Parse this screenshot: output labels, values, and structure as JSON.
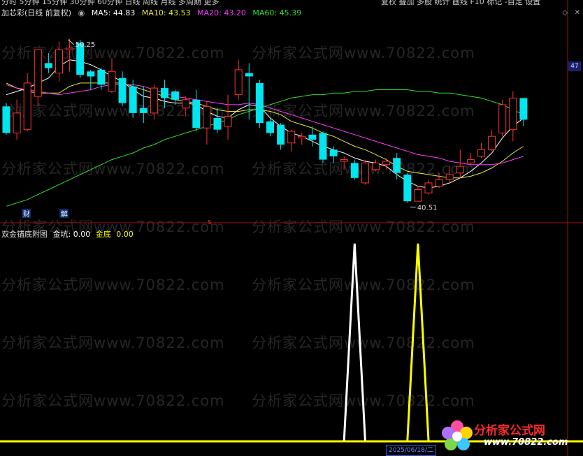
{
  "app": {
    "stock_title": "加芯彩(日线 前复权)",
    "top_tabs": [
      "分时",
      "5分钟",
      "15分钟",
      "30分钟",
      "60分钟",
      "日线",
      "周线",
      "月线",
      "多周期",
      "更多"
    ],
    "top_right": [
      "复权",
      "叠加",
      "多股",
      "统计",
      "画线",
      "F10",
      "标记",
      "-自定",
      "设置"
    ]
  },
  "main_legend": {
    "ma5": "MA5: 44.83",
    "ma10": "MA10: 43.53",
    "ma20": "MA20: 43.20",
    "ma60": "MA60: 45.39"
  },
  "sub_legend": {
    "title": "双金锚底附图",
    "jinkeng": "金坑: 0.00",
    "jindi": "金底",
    "jindi_val": "0.00"
  },
  "annotations": {
    "high_label": "50.25",
    "low_label": "40.51",
    "cai_badge": "财",
    "jie_badge": "解",
    "s_marker": "S",
    "right_badge": "47",
    "date_tag": "2025/06/18/二"
  },
  "logo": {
    "brand": "分析家公式网",
    "url": "www.70822.com"
  },
  "watermark": "分析家公式网www.70822.com",
  "colors": {
    "up": "#ff3232",
    "down": "#00e5ee",
    "ma5": "#ffffff",
    "ma10": "#e8e83a",
    "ma20": "#ff3cff",
    "ma60": "#33dd33",
    "white_spike": "#ffffff",
    "yellow_spike": "#ffff00",
    "axis": "#a01010"
  },
  "chart_data": [
    {
      "type": "candlestick",
      "title": "加芯彩(日线 前复权)",
      "ylim": [
        39.5,
        51.5
      ],
      "candles": [
        {
          "o": 46.2,
          "c": 44.6,
          "h": 46.4,
          "l": 44.5
        },
        {
          "o": 44.6,
          "c": 45.8,
          "h": 46.6,
          "l": 44.2
        },
        {
          "o": 44.8,
          "c": 47.6,
          "h": 48.2,
          "l": 44.7
        },
        {
          "o": 46.8,
          "c": 49.6,
          "h": 49.6,
          "l": 46.2
        },
        {
          "o": 48.8,
          "c": 48.5,
          "h": 49.4,
          "l": 48.2
        },
        {
          "o": 48.2,
          "c": 49.6,
          "h": 50.1,
          "l": 47.7
        },
        {
          "o": 49.6,
          "c": 49.7,
          "h": 50.25,
          "l": 48.3
        },
        {
          "o": 50.0,
          "c": 48.1,
          "h": 50.2,
          "l": 47.9
        },
        {
          "o": 48.3,
          "c": 48.0,
          "h": 48.4,
          "l": 47.2
        },
        {
          "o": 48.4,
          "c": 47.5,
          "h": 48.5,
          "l": 47.2
        },
        {
          "o": 47.1,
          "c": 48.3,
          "h": 49.1,
          "l": 47.0
        },
        {
          "o": 47.9,
          "c": 46.4,
          "h": 48.3,
          "l": 46.2
        },
        {
          "o": 47.4,
          "c": 45.8,
          "h": 47.8,
          "l": 45.5
        },
        {
          "o": 46.1,
          "c": 45.8,
          "h": 47.4,
          "l": 45.2
        },
        {
          "o": 45.8,
          "c": 47.3,
          "h": 47.5,
          "l": 45.4
        },
        {
          "o": 47.3,
          "c": 46.7,
          "h": 47.8,
          "l": 46.1
        },
        {
          "o": 47.1,
          "c": 46.6,
          "h": 47.2,
          "l": 46.3
        },
        {
          "o": 46.1,
          "c": 46.6,
          "h": 46.8,
          "l": 45.6
        },
        {
          "o": 46.6,
          "c": 44.9,
          "h": 47.2,
          "l": 44.7
        },
        {
          "o": 44.9,
          "c": 46.2,
          "h": 46.5,
          "l": 43.9
        },
        {
          "o": 45.5,
          "c": 44.8,
          "h": 46.1,
          "l": 44.6
        },
        {
          "o": 45.0,
          "c": 45.6,
          "h": 46.9,
          "l": 44.2
        },
        {
          "o": 46.9,
          "c": 48.4,
          "h": 49.0,
          "l": 46.6
        },
        {
          "o": 48.2,
          "c": 48.0,
          "h": 48.8,
          "l": 45.4
        },
        {
          "o": 47.6,
          "c": 45.2,
          "h": 47.8,
          "l": 44.9
        },
        {
          "o": 45.3,
          "c": 44.6,
          "h": 45.5,
          "l": 44.4
        },
        {
          "o": 45.1,
          "c": 43.9,
          "h": 45.2,
          "l": 43.6
        },
        {
          "o": 44.0,
          "c": 44.7,
          "h": 44.8,
          "l": 43.5
        },
        {
          "o": 44.3,
          "c": 44.4,
          "h": 44.6,
          "l": 43.9
        },
        {
          "o": 44.5,
          "c": 44.2,
          "h": 45.0,
          "l": 43.8
        },
        {
          "o": 44.6,
          "c": 43.0,
          "h": 44.7,
          "l": 42.8
        },
        {
          "o": 43.6,
          "c": 43.2,
          "h": 43.8,
          "l": 42.8
        },
        {
          "o": 42.9,
          "c": 43.0,
          "h": 43.2,
          "l": 42.4
        },
        {
          "o": 42.8,
          "c": 41.9,
          "h": 43.0,
          "l": 41.8
        },
        {
          "o": 41.6,
          "c": 42.8,
          "h": 43.0,
          "l": 41.5
        },
        {
          "o": 42.4,
          "c": 42.8,
          "h": 43.0,
          "l": 42.3
        },
        {
          "o": 42.7,
          "c": 42.9,
          "h": 43.1,
          "l": 42.4
        },
        {
          "o": 43.1,
          "c": 42.2,
          "h": 43.4,
          "l": 41.8
        },
        {
          "o": 42.1,
          "c": 40.5,
          "h": 42.2,
          "l": 40.4
        },
        {
          "o": 40.5,
          "c": 41.2,
          "h": 41.4,
          "l": 40.51
        },
        {
          "o": 41.0,
          "c": 41.6,
          "h": 41.8,
          "l": 40.9
        },
        {
          "o": 41.4,
          "c": 41.8,
          "h": 42.2,
          "l": 41.3
        },
        {
          "o": 41.8,
          "c": 42.1,
          "h": 42.6,
          "l": 41.6
        },
        {
          "o": 42.2,
          "c": 42.6,
          "h": 43.6,
          "l": 41.9
        },
        {
          "o": 42.8,
          "c": 43.0,
          "h": 43.4,
          "l": 42.7
        },
        {
          "o": 43.2,
          "c": 43.6,
          "h": 44.0,
          "l": 43.1
        },
        {
          "o": 43.6,
          "c": 44.4,
          "h": 44.8,
          "l": 43.5
        },
        {
          "o": 44.6,
          "c": 46.3,
          "h": 46.6,
          "l": 44.4
        },
        {
          "o": 44.8,
          "c": 46.7,
          "h": 47.1,
          "l": 44.1
        },
        {
          "o": 46.7,
          "c": 45.4,
          "h": 46.7,
          "l": 45.0
        }
      ],
      "series": [
        {
          "name": "MA5",
          "values": [
            46.9,
            47.1,
            47.3,
            47.6,
            47.9,
            48.6,
            49.0,
            48.9,
            48.7,
            48.4,
            48.0,
            47.7,
            47.2,
            46.8,
            46.7,
            46.5,
            46.4,
            46.4,
            46.3,
            45.9,
            45.6,
            45.5,
            46.0,
            46.3,
            46.2,
            45.5,
            45.0,
            44.6,
            44.4,
            44.1,
            43.8,
            43.6,
            43.4,
            43.1,
            42.9,
            42.8,
            42.6,
            42.1,
            41.7,
            41.4,
            41.3,
            41.4,
            41.6,
            41.9,
            42.3,
            42.8,
            43.4,
            44.3,
            45.0,
            45.5
          ]
        },
        {
          "name": "MA10",
          "values": [
            47.6,
            47.3,
            47.1,
            47.0,
            47.0,
            47.0,
            47.4,
            47.6,
            47.6,
            47.6,
            47.6,
            47.6,
            47.4,
            47.2,
            47.0,
            46.8,
            46.6,
            46.5,
            46.4,
            46.2,
            46.0,
            45.9,
            45.9,
            46.0,
            46.0,
            45.9,
            45.7,
            45.3,
            45.1,
            44.9,
            44.6,
            44.4,
            44.1,
            43.8,
            43.6,
            43.3,
            43.0,
            42.6,
            42.3,
            42.2,
            42.1,
            42.0,
            41.9,
            41.9,
            42.0,
            42.2,
            42.5,
            42.9,
            43.4,
            43.8
          ]
        },
        {
          "name": "MA20",
          "values": [
            47.5,
            47.3,
            47.2,
            47.1,
            47.0,
            46.9,
            47.0,
            47.1,
            47.2,
            47.4,
            47.5,
            47.5,
            47.5,
            47.4,
            47.2,
            47.0,
            46.8,
            46.7,
            46.6,
            46.5,
            46.4,
            46.3,
            46.3,
            46.4,
            46.3,
            46.1,
            45.9,
            45.7,
            45.5,
            45.3,
            45.1,
            44.9,
            44.7,
            44.5,
            44.3,
            44.1,
            43.9,
            43.7,
            43.5,
            43.3,
            43.2,
            43.1,
            42.9,
            42.8,
            42.7,
            42.7,
            42.7,
            42.8,
            43.0,
            43.2
          ]
        },
        {
          "name": "MA60",
          "values": [
            40.2,
            40.4,
            40.6,
            40.9,
            41.2,
            41.5,
            41.8,
            42.1,
            42.4,
            42.7,
            43.0,
            43.2,
            43.4,
            43.7,
            43.9,
            44.2,
            44.4,
            44.6,
            44.8,
            45.0,
            45.2,
            45.4,
            45.7,
            45.9,
            46.1,
            46.3,
            46.5,
            46.7,
            46.8,
            46.9,
            46.9,
            47.0,
            47.0,
            47.1,
            47.1,
            47.2,
            47.2,
            47.2,
            47.2,
            47.1,
            47.1,
            47.0,
            47.0,
            46.9,
            46.8,
            46.7,
            46.5,
            46.3,
            46.0,
            45.7
          ]
        }
      ]
    },
    {
      "type": "line",
      "title": "双金锚底附图",
      "ylim": [
        0,
        1.0
      ],
      "series": [
        {
          "name": "金坑",
          "values": [
            0,
            0,
            0,
            0,
            0,
            0,
            0,
            0,
            0,
            0,
            0,
            0,
            0,
            0,
            0,
            0,
            0,
            0,
            0,
            0,
            0,
            0,
            0,
            0,
            0,
            0,
            0,
            0,
            0,
            0,
            0,
            0,
            0,
            0.98,
            0,
            0,
            0,
            0,
            0,
            0,
            0,
            0,
            0,
            0,
            0,
            0,
            0,
            0,
            0,
            0
          ]
        },
        {
          "name": "金底",
          "values": [
            0,
            0,
            0,
            0,
            0,
            0,
            0,
            0,
            0,
            0,
            0,
            0,
            0,
            0,
            0,
            0,
            0,
            0,
            0,
            0,
            0,
            0,
            0,
            0,
            0,
            0,
            0,
            0,
            0,
            0,
            0,
            0,
            0,
            0,
            0,
            0,
            0,
            0,
            0,
            0.98,
            0,
            0,
            0,
            0,
            0,
            0,
            0,
            0,
            0,
            0
          ]
        }
      ]
    }
  ]
}
